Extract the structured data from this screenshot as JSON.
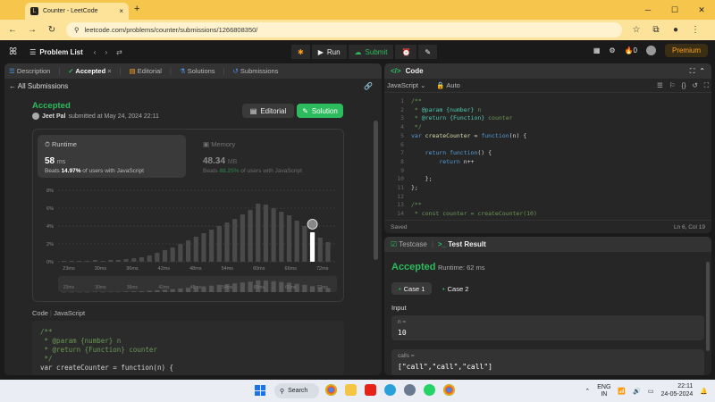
{
  "browser": {
    "tab_title": "Counter - LeetCode",
    "url": "leetcode.com/problems/counter/submissions/1266808350/"
  },
  "nav": {
    "problem_list": "Problem List",
    "run": "Run",
    "submit": "Submit",
    "notif_count": "0",
    "premium": "Premium"
  },
  "left": {
    "tabs": [
      "Description",
      "Accepted",
      "Editorial",
      "Solutions",
      "Submissions"
    ],
    "all_submissions": "All Submissions",
    "status": "Accepted",
    "user": "Jeet Pal",
    "submitted": "submitted at May 24, 2024 22:11",
    "editorial_btn": "Editorial",
    "solution_btn": "Solution",
    "runtime_title": "Runtime",
    "runtime_value": "58",
    "runtime_unit": "ms",
    "runtime_beats_pre": "Beats",
    "runtime_beats_pct": "14.97%",
    "runtime_beats_post": "of users with JavaScript",
    "memory_title": "Memory",
    "memory_value": "48.34",
    "memory_unit": "MB",
    "memory_beats_pre": "Beats",
    "memory_beats_pct": "88.25%",
    "memory_beats_post": "of users with JavaScript",
    "code_label": "Code",
    "code_lang": "JavaScript",
    "code_lines": [
      "/**",
      " * @param {number} n",
      " * @return {Function} counter",
      " */",
      "var createCounter = function(n) {"
    ]
  },
  "chart_data": {
    "type": "bar",
    "y_ticks": [
      "8%",
      "6%",
      "4%",
      "2%",
      "0%"
    ],
    "ylim": [
      0,
      8
    ],
    "x_ticks": [
      "23ms",
      "30ms",
      "36ms",
      "42ms",
      "48ms",
      "54ms",
      "60ms",
      "66ms",
      "72ms",
      "78ms"
    ],
    "values": [
      0.1,
      0.1,
      0.1,
      0.1,
      0.2,
      0.1,
      0.2,
      0.2,
      0.3,
      0.4,
      0.5,
      0.7,
      1.0,
      1.3,
      1.6,
      2.0,
      2.4,
      2.8,
      3.2,
      3.6,
      4.0,
      4.4,
      4.8,
      5.3,
      5.8,
      6.5,
      6.4,
      6.0,
      5.6,
      5.2,
      4.6,
      4.0,
      3.3,
      2.7,
      2.2
    ],
    "highlight_index": 32,
    "highlight_value": 3.3
  },
  "editor": {
    "title": "Code",
    "language": "JavaScript",
    "mode": "Auto",
    "line_numbers": [
      "1",
      "2",
      "3",
      "4",
      "5",
      "6",
      "7",
      "8",
      "9",
      "10",
      "11",
      "12",
      "13",
      "14"
    ],
    "status_left": "Saved",
    "status_right": "Ln 6, Col 19"
  },
  "result": {
    "testcase_tab": "Testcase",
    "result_tab": "Test Result",
    "status": "Accepted",
    "runtime": "Runtime: 62 ms",
    "case1": "Case 1",
    "case2": "Case 2",
    "input_label": "Input",
    "n_label": "n =",
    "n_value": "10",
    "calls_label": "calls =",
    "calls_value": "[\"call\",\"call\",\"call\"]"
  },
  "taskbar": {
    "search": "Search",
    "lang1": "ENG",
    "lang2": "IN",
    "time": "22:11",
    "date": "24-05-2024"
  }
}
